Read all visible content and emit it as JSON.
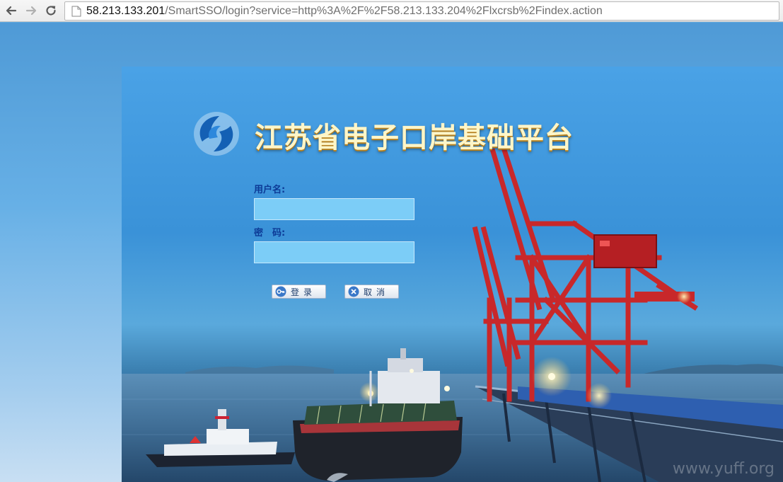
{
  "browser": {
    "url_host": "58.213.133.201",
    "url_path": "/SmartSSO/login?service=http%3A%2F%2F58.213.133.204%2Flxcrsb%2Findex.action",
    "icons": [
      "back-icon",
      "forward-icon",
      "reload-icon",
      "page-icon"
    ]
  },
  "header": {
    "title": "江苏省电子口岸基础平台"
  },
  "login": {
    "username_label": "用户名:",
    "password_label": "密　码:",
    "username_value": "",
    "password_value": "",
    "login_button": "登录",
    "cancel_button": "取消"
  },
  "watermark": "www.yuff.org",
  "colors": {
    "label": "#0c3a96",
    "input_bg": "#7ccdf7",
    "title": "#fff6c8",
    "crane_red": "#c8282a"
  }
}
